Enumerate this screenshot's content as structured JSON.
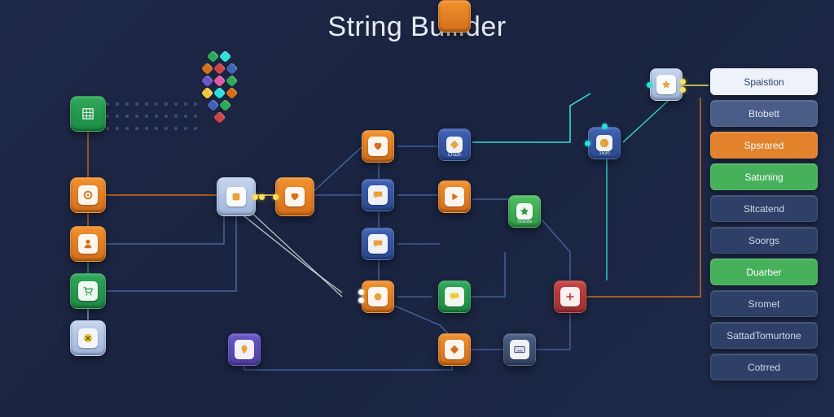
{
  "title": "String Buillder",
  "side_items": [
    {
      "label": "Spaistion",
      "variant": "si-white"
    },
    {
      "label": "Btobett",
      "variant": "si-slate"
    },
    {
      "label": "Spsrared",
      "variant": "si-orange"
    },
    {
      "label": "Satuning",
      "variant": "si-green"
    },
    {
      "label": "Sltcatend",
      "variant": "si-navy"
    },
    {
      "label": "Soorgs",
      "variant": "si-navy"
    },
    {
      "label": "Duarber",
      "variant": "si-green"
    },
    {
      "label": "Sromet",
      "variant": "si-navy"
    },
    {
      "label": "SattadTomurtone",
      "variant": "si-navy"
    },
    {
      "label": "Cotrred",
      "variant": "si-navy"
    }
  ],
  "nodes": {
    "grid_source": {
      "color": "c-green",
      "icon": "grid-icon"
    },
    "col_in_1": {
      "color": "c-orange",
      "icon": "target-icon"
    },
    "col_in_2": {
      "color": "c-orange",
      "icon": "person-icon"
    },
    "col_in_3": {
      "color": "c-green",
      "icon": "cart-icon"
    },
    "col_in_4": {
      "color": "c-lblue",
      "icon": "cross-icon"
    },
    "hub_pale": {
      "color": "c-lblue",
      "icon": "paint-icon"
    },
    "hub_orange": {
      "color": "c-orange",
      "icon": "heart-icon"
    },
    "mid_blue_1": {
      "color": "c-blue",
      "icon": "chat-icon"
    },
    "mid_blue_2": {
      "color": "c-blue",
      "icon": "diamond-icon",
      "label": "Chartr"
    },
    "mid_blue_3": {
      "color": "c-blue",
      "icon": "chat-icon"
    },
    "mid_orange_1": {
      "color": "c-orange",
      "icon": "heart-icon"
    },
    "mid_orange_2": {
      "color": "c-orange",
      "icon": "play-icon"
    },
    "mid_orange_3": {
      "color": "c-orange",
      "icon": "badge-icon"
    },
    "mid_orange_4": {
      "color": "c-orange",
      "icon": "diamond-icon"
    },
    "state_green": {
      "color": "c-green2",
      "icon": "star-icon",
      "label": "Sceste"
    },
    "chat_green": {
      "color": "c-green",
      "icon": "speech-icon"
    },
    "bottom_purple": {
      "color": "c-purple",
      "icon": "pin-icon"
    },
    "bottom_keyboard": {
      "color": "c-slate",
      "icon": "keyboard-icon"
    },
    "right_blue_info": {
      "color": "c-blue",
      "icon": "info-icon",
      "label": "1630"
    },
    "top_right_star": {
      "color": "c-lblue",
      "icon": "star-icon"
    },
    "error_red": {
      "color": "c-red",
      "icon": "plus-icon"
    }
  },
  "cluster_colors": [
    "#2fa85a",
    "#d46f1a",
    "#c94444",
    "#3f62b5",
    "#6a57c9",
    "#2de0d8",
    "#f0c93e",
    "#e05aa8"
  ]
}
